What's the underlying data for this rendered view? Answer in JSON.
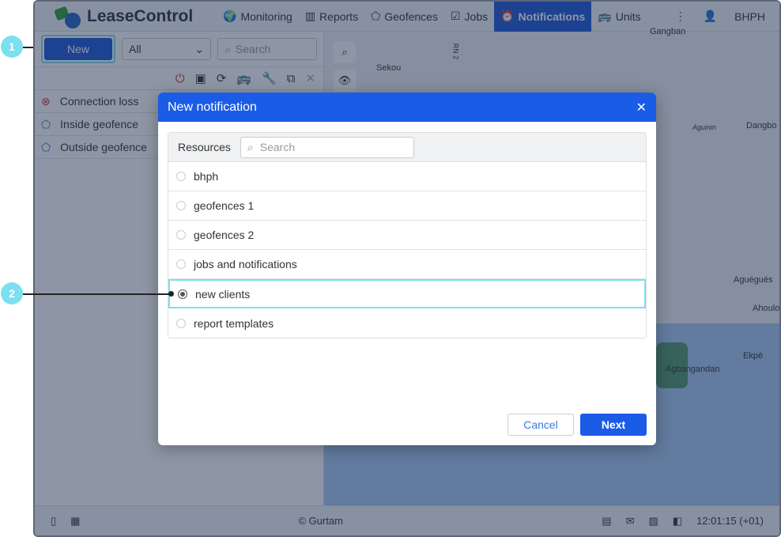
{
  "app": {
    "logo": "LeaseControl",
    "user": "BHPH"
  },
  "nav": [
    {
      "label": "Monitoring",
      "icon": "🌍"
    },
    {
      "label": "Reports",
      "icon": "▥"
    },
    {
      "label": "Geofences",
      "icon": "⬠"
    },
    {
      "label": "Jobs",
      "icon": "☑"
    },
    {
      "label": "Notifications",
      "icon": "⏰"
    },
    {
      "label": "Units",
      "icon": "🚌"
    }
  ],
  "left": {
    "new_label": "New",
    "filter": "All",
    "search_placeholder": "Search",
    "items": [
      {
        "label": "Connection loss",
        "icon": "⊗",
        "color": "#c0392b"
      },
      {
        "label": "Inside geofence",
        "icon": "⬠",
        "color": "#2a6fd6"
      },
      {
        "label": "Outside geofence",
        "icon": "⬠",
        "color": "#2a6fd6"
      }
    ]
  },
  "map": {
    "labels": [
      "Sekou",
      "Gangban",
      "Aguinin",
      "Dangbo",
      "Aguégués",
      "Ahoulo",
      "Ekpè",
      "Agbangandan",
      "RN 2"
    ]
  },
  "footer": {
    "copyright": "© Gurtam",
    "time": "12:01:15 (+01)"
  },
  "modal": {
    "title": "New notification",
    "resources_label": "Resources",
    "search_placeholder": "Search",
    "resources": [
      "bhph",
      "geofences 1",
      "geofences 2",
      "jobs and notifications",
      "new clients",
      "report templates"
    ],
    "selected": "new clients",
    "cancel": "Cancel",
    "next": "Next"
  },
  "callouts": [
    "1",
    "2"
  ]
}
